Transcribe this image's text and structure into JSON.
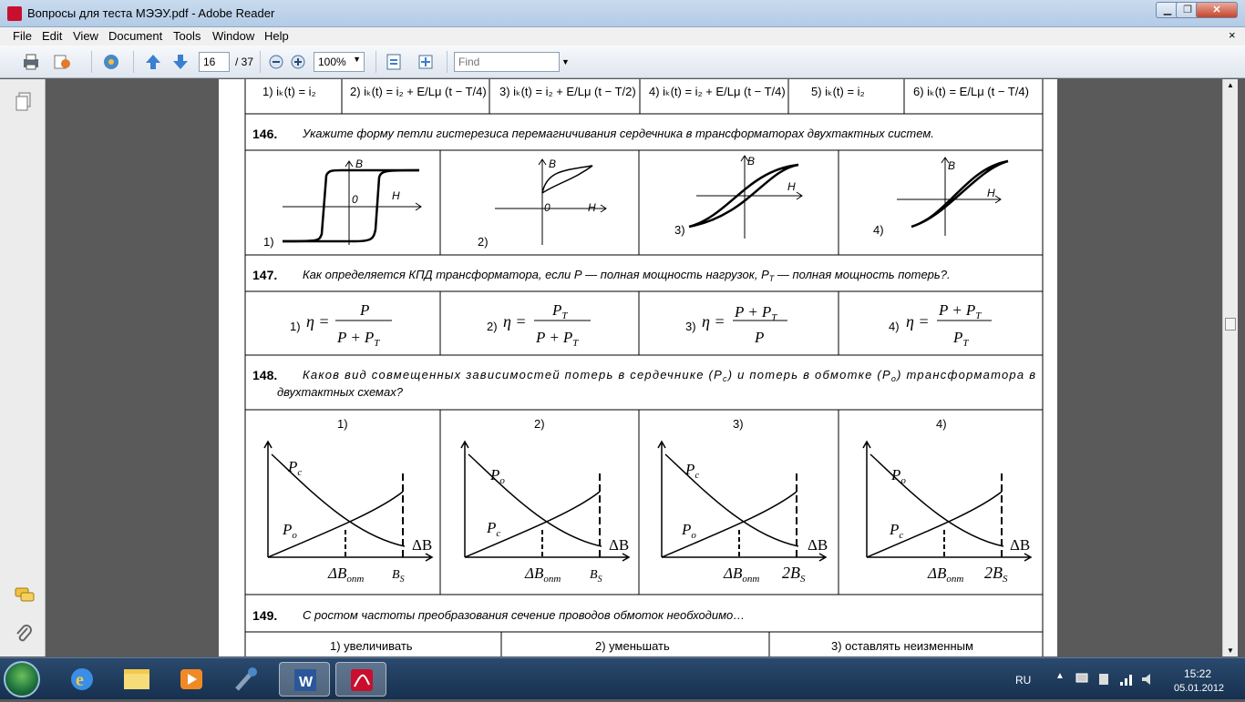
{
  "window": {
    "title": "Вопросы для теста МЭЭУ.pdf - Adobe Reader",
    "min": "▁",
    "max": "❐",
    "close": "✕"
  },
  "menu": [
    "File",
    "Edit",
    "View",
    "Document",
    "Tools",
    "Window",
    "Help"
  ],
  "menu_close": "×",
  "toolbar": {
    "page": "16",
    "page_of": "/ 37",
    "zoom": "100%",
    "find_placeholder": "Find"
  },
  "q145_row": {
    "o1": "1) iₖ(t) = i₂",
    "o2": "2) iₖ(t) = i₂ + E/Lμ (t − T/4)",
    "o3": "3) iₖ(t) = i₂ + E/Lμ (t − T/2)",
    "o4": "4) iₖ(t) = i₂ + E/Lμ (t − T/4)",
    "o5": "5) iₖ(t) = i₂",
    "o6": "6) iₖ(t) = E/Lμ (t − T/4)"
  },
  "q146": {
    "num": "146.",
    "text": "Укажите форму петли гистерезиса перемагничивания сердечника в трансформаторах двухтактных систем.",
    "opts": [
      "1)",
      "2)",
      "3)",
      "4)"
    ],
    "axis_b": "B",
    "axis_h": "H",
    "zero": "0"
  },
  "q147": {
    "num": "147.",
    "text": "Как определяется КПД трансформатора, если Р — полная мощность нагрузок, Р",
    "text_sub": "Т",
    "text_end": " — полная мощность потерь?.",
    "opts": [
      "1)",
      "2)",
      "3)",
      "4)"
    ],
    "eta": "η =",
    "p": "P",
    "pt": "P",
    "t": "T",
    "plus": "+"
  },
  "q148": {
    "num": "148.",
    "text1": "Каков вид совмещенных  зависимостей потерь в сердечнике (Р",
    "sub_c": "c",
    "text_mid": ") и потерь в обмотке (Р",
    "sub_o": "о",
    "text2": ") трансформатора в",
    "text3": "двухтактных схемах?",
    "opts": [
      "1)",
      "2)",
      "3)",
      "4)"
    ],
    "pc": "P",
    "po": "P",
    "c": "c",
    "o": "o",
    "db": "ΔB",
    "dbopt": "ΔB",
    "opt": "опт",
    "bs": "B",
    "s": "S",
    "two_bs": "2B"
  },
  "q149": {
    "num": "149.",
    "text": "С ростом частоты преобразования сечение проводов обмоток необходимо…",
    "opts": [
      "1) увеличивать",
      "2) уменьшать",
      "3) оставлять неизменным"
    ]
  },
  "tray": {
    "lang": "RU",
    "time": "15:22",
    "date": "05.01.2012"
  }
}
